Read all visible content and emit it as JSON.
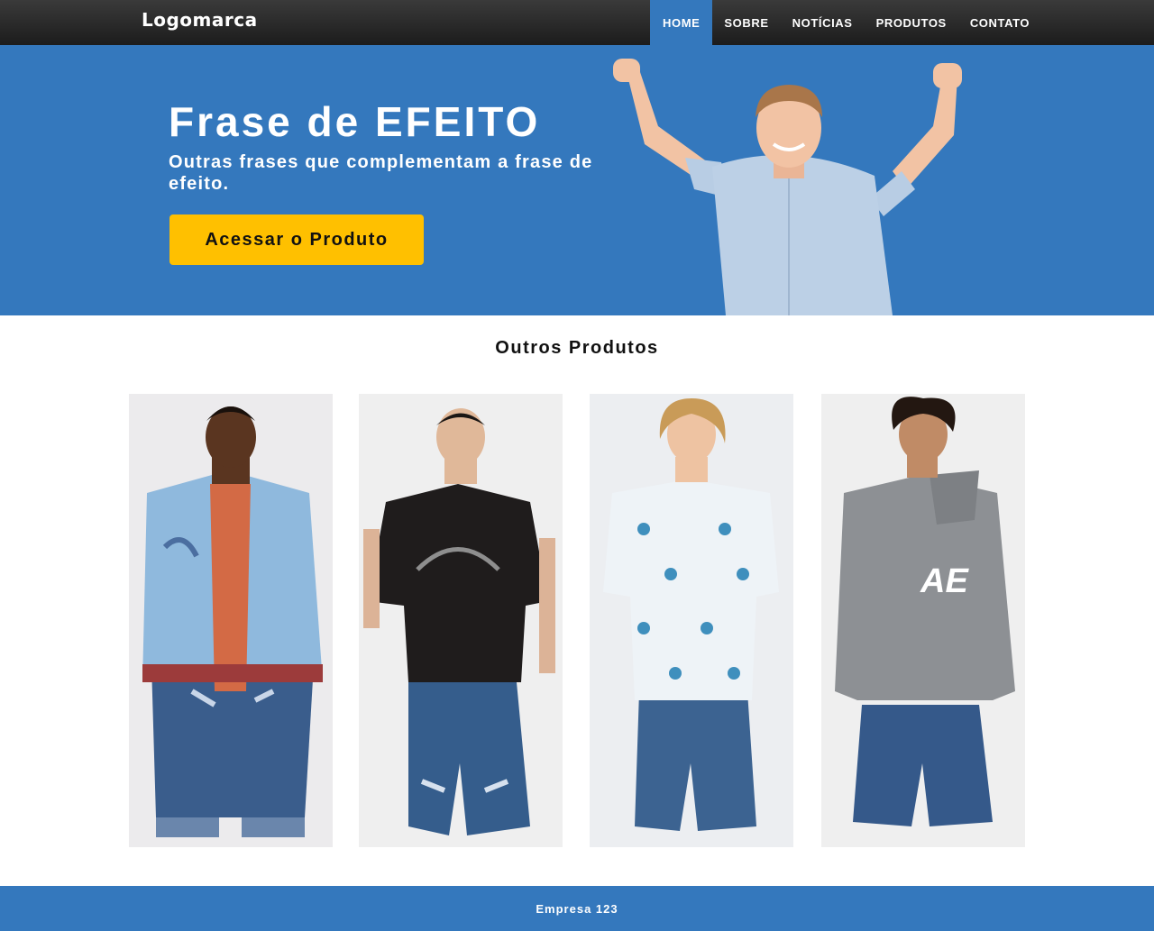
{
  "header": {
    "logo": "Logomarca",
    "nav": [
      {
        "label": "HOME",
        "active": true
      },
      {
        "label": "SOBRE",
        "active": false
      },
      {
        "label": "NOTÍCIAS",
        "active": false
      },
      {
        "label": "PRODUTOS",
        "active": false
      },
      {
        "label": "CONTATO",
        "active": false
      }
    ]
  },
  "hero": {
    "title": "Frase de EFEITO",
    "subtitle": "Outras frases que complementam a frase de efeito.",
    "cta_label": "Acessar o Produto",
    "image": "celebrating-man-photo"
  },
  "products": {
    "title": "Outros Produtos",
    "items": [
      {
        "image": "model-bomber-jacket-photo"
      },
      {
        "image": "model-black-tshirt-photo"
      },
      {
        "image": "model-print-shirt-photo"
      },
      {
        "image": "model-gray-hoodie-photo",
        "print": "AE"
      }
    ]
  },
  "footer": {
    "text": "Empresa 123"
  },
  "colors": {
    "primary": "#3478bd",
    "accent": "#ffc000",
    "header_dark": "#2a2a2a"
  }
}
